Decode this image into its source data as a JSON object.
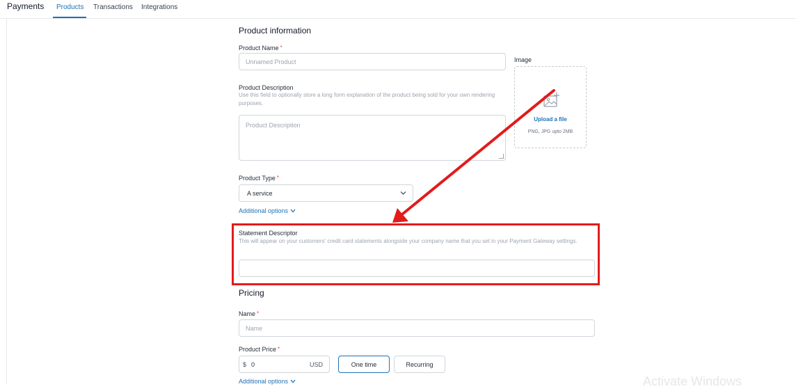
{
  "header": {
    "app_title": "Payments",
    "tabs": [
      {
        "label": "Products",
        "active": true
      },
      {
        "label": "Transactions",
        "active": false
      },
      {
        "label": "Integrations",
        "active": false
      }
    ]
  },
  "product_info": {
    "section_title": "Product information",
    "name": {
      "label": "Product Name",
      "required": "*",
      "placeholder": "Unnamed Product"
    },
    "description": {
      "label": "Product Description",
      "help": "Use this field to optionally store a long form explanation of the product being sold for your own rendering purposes.",
      "placeholder": "Product Description"
    },
    "type": {
      "label": "Product Type",
      "required": "*",
      "selected": "A service"
    },
    "additional_options": "Additional options",
    "image": {
      "label": "Image",
      "upload_link": "Upload a file",
      "hint": "PNG, JPG upto 2MB"
    },
    "statement_descriptor": {
      "label": "Statement Descriptor",
      "help": "This will appear on your customers' credit card statements alongside your company name that you set in your Payment Gateway settings.",
      "value": ""
    }
  },
  "pricing": {
    "section_title": "Pricing",
    "name": {
      "label": "Name",
      "required": "*",
      "placeholder": "Name"
    },
    "price": {
      "label": "Product Price",
      "required": "*",
      "currency_symbol": "$",
      "value": "0",
      "currency": "USD"
    },
    "billing_options": [
      "One time",
      "Recurring"
    ],
    "selected_billing": "One time",
    "additional_options": "Additional options"
  },
  "annotation": {
    "color": "#e21b1b"
  },
  "watermark": "Activate Windows"
}
